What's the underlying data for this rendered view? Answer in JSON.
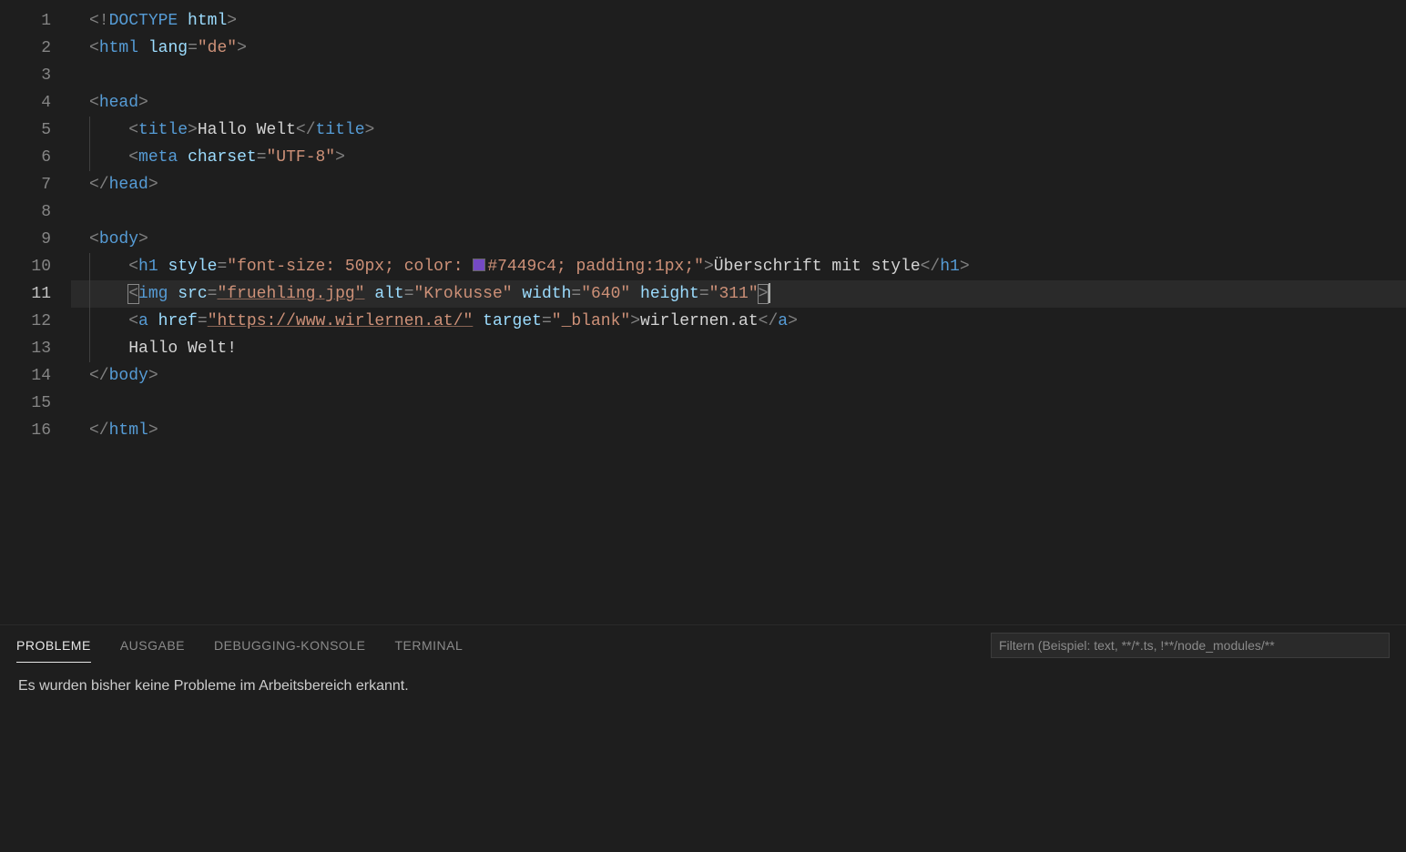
{
  "editor": {
    "lineCount": 16,
    "currentLine": 11,
    "tokens": {
      "l1": [
        {
          "t": "<!",
          "c": "pun"
        },
        {
          "t": "DOCTYPE",
          "c": "tag"
        },
        {
          "t": " ",
          "c": "pun"
        },
        {
          "t": "html",
          "c": "attr"
        },
        {
          "t": ">",
          "c": "pun"
        }
      ],
      "l2": [
        {
          "t": "<",
          "c": "pun"
        },
        {
          "t": "html",
          "c": "tag"
        },
        {
          "t": " ",
          "c": "txt"
        },
        {
          "t": "lang",
          "c": "attr"
        },
        {
          "t": "=",
          "c": "pun"
        },
        {
          "t": "\"de\"",
          "c": "str"
        },
        {
          "t": ">",
          "c": "pun"
        }
      ],
      "l4": [
        {
          "t": "<",
          "c": "pun"
        },
        {
          "t": "head",
          "c": "tag"
        },
        {
          "t": ">",
          "c": "pun"
        }
      ],
      "l5": [
        {
          "t": "<",
          "c": "pun"
        },
        {
          "t": "title",
          "c": "tag"
        },
        {
          "t": ">",
          "c": "pun"
        },
        {
          "t": "Hallo Welt",
          "c": "txt"
        },
        {
          "t": "</",
          "c": "pun"
        },
        {
          "t": "title",
          "c": "tag"
        },
        {
          "t": ">",
          "c": "pun"
        }
      ],
      "l6": [
        {
          "t": "<",
          "c": "pun"
        },
        {
          "t": "meta",
          "c": "tag"
        },
        {
          "t": " ",
          "c": "txt"
        },
        {
          "t": "charset",
          "c": "attr"
        },
        {
          "t": "=",
          "c": "pun"
        },
        {
          "t": "\"UTF-8\"",
          "c": "str"
        },
        {
          "t": ">",
          "c": "pun"
        }
      ],
      "l7": [
        {
          "t": "</",
          "c": "pun"
        },
        {
          "t": "head",
          "c": "tag"
        },
        {
          "t": ">",
          "c": "pun"
        }
      ],
      "l9": [
        {
          "t": "<",
          "c": "pun"
        },
        {
          "t": "body",
          "c": "tag"
        },
        {
          "t": ">",
          "c": "pun"
        }
      ],
      "l10": [
        {
          "t": "<",
          "c": "pun"
        },
        {
          "t": "h1",
          "c": "tag"
        },
        {
          "t": " ",
          "c": "txt"
        },
        {
          "t": "style",
          "c": "attr"
        },
        {
          "t": "=",
          "c": "pun"
        },
        {
          "t": "\"font-size: 50px; color: ",
          "c": "str"
        },
        {
          "t": "COLORBOX",
          "c": "colorbox"
        },
        {
          "t": "#7449c4; padding:1px;\"",
          "c": "str"
        },
        {
          "t": ">",
          "c": "pun"
        },
        {
          "t": "Überschrift mit style",
          "c": "txt"
        },
        {
          "t": "</",
          "c": "pun"
        },
        {
          "t": "h1",
          "c": "tag"
        },
        {
          "t": ">",
          "c": "pun"
        }
      ],
      "l11": [
        {
          "t": "<",
          "c": "pun bracket-hl"
        },
        {
          "t": "img",
          "c": "tag"
        },
        {
          "t": " ",
          "c": "txt"
        },
        {
          "t": "src",
          "c": "attr"
        },
        {
          "t": "=",
          "c": "pun"
        },
        {
          "t": "\"fruehling.jpg\"",
          "c": "str underline"
        },
        {
          "t": " ",
          "c": "txt"
        },
        {
          "t": "alt",
          "c": "attr"
        },
        {
          "t": "=",
          "c": "pun"
        },
        {
          "t": "\"Krokusse\"",
          "c": "str"
        },
        {
          "t": " ",
          "c": "txt"
        },
        {
          "t": "width",
          "c": "attr"
        },
        {
          "t": "=",
          "c": "pun"
        },
        {
          "t": "\"640\"",
          "c": "str"
        },
        {
          "t": " ",
          "c": "txt"
        },
        {
          "t": "height",
          "c": "attr"
        },
        {
          "t": "=",
          "c": "pun"
        },
        {
          "t": "\"311\"",
          "c": "str"
        },
        {
          "t": ">",
          "c": "pun bracket-hl"
        },
        {
          "t": "CURSOR",
          "c": "cursor"
        }
      ],
      "l12": [
        {
          "t": "<",
          "c": "pun"
        },
        {
          "t": "a",
          "c": "tag"
        },
        {
          "t": " ",
          "c": "txt"
        },
        {
          "t": "href",
          "c": "attr"
        },
        {
          "t": "=",
          "c": "pun"
        },
        {
          "t": "\"https://www.wirlernen.at/\"",
          "c": "str underline"
        },
        {
          "t": " ",
          "c": "txt"
        },
        {
          "t": "target",
          "c": "attr"
        },
        {
          "t": "=",
          "c": "pun"
        },
        {
          "t": "\"_blank\"",
          "c": "str"
        },
        {
          "t": ">",
          "c": "pun"
        },
        {
          "t": "wirlernen.at",
          "c": "txt"
        },
        {
          "t": "</",
          "c": "pun"
        },
        {
          "t": "a",
          "c": "tag"
        },
        {
          "t": ">",
          "c": "pun"
        }
      ],
      "l13": [
        {
          "t": "Hallo Welt!",
          "c": "txt"
        }
      ],
      "l14": [
        {
          "t": "</",
          "c": "pun"
        },
        {
          "t": "body",
          "c": "tag"
        },
        {
          "t": ">",
          "c": "pun"
        }
      ],
      "l16": [
        {
          "t": "</",
          "c": "pun"
        },
        {
          "t": "html",
          "c": "tag"
        },
        {
          "t": ">",
          "c": "pun"
        }
      ]
    },
    "indent": {
      "l1": 0,
      "l2": 0,
      "l3": 0,
      "l4": 0,
      "l5": 1,
      "l6": 1,
      "l7": 0,
      "l8": 0,
      "l9": 0,
      "l10": 1,
      "l11": 1,
      "l12": 1,
      "l13": 1,
      "l14": 0,
      "l15": 0,
      "l16": 0
    }
  },
  "panel": {
    "tabs": [
      "PROBLEME",
      "AUSGABE",
      "DEBUGGING-KONSOLE",
      "TERMINAL"
    ],
    "activeTab": 0,
    "filterPlaceholder": "Filtern (Beispiel: text, **/*.ts, !**/node_modules/**",
    "message": "Es wurden bisher keine Probleme im Arbeitsbereich erkannt."
  }
}
